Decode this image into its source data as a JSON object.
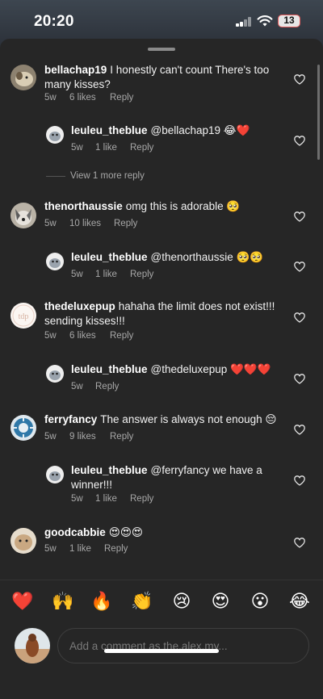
{
  "status": {
    "time": "20:20",
    "battery": "13"
  },
  "comments": [
    {
      "user": "bellachap19",
      "text": "I honestly can't count There's too many kisses?",
      "time": "5w",
      "likes": "6 likes",
      "reply": "Reply",
      "avatar": "avatar-dog"
    },
    {
      "user": "leuleu_theblue",
      "text": "@bellachap19 😂❤️",
      "time": "5w",
      "likes": "1 like",
      "reply": "Reply",
      "avatar": "avatar-leuleu"
    },
    {
      "user": "thenorthaussie",
      "text": "omg this is adorable 🥺",
      "time": "5w",
      "likes": "10 likes",
      "reply": "Reply",
      "avatar": "avatar-aussie"
    },
    {
      "user": "leuleu_theblue",
      "text": "@thenorthaussie 🥺🥺",
      "time": "5w",
      "likes": "1 like",
      "reply": "Reply",
      "avatar": "avatar-leuleu"
    },
    {
      "user": "thedeluxepup",
      "text": "hahaha the limit does not exist!!! sending kisses!!!",
      "time": "5w",
      "likes": "6 likes",
      "reply": "Reply",
      "avatar": "avatar-deluxepup"
    },
    {
      "user": "leuleu_theblue",
      "text": "@thedeluxepup ❤️❤️❤️",
      "time": "5w",
      "likes": "",
      "reply": "Reply",
      "avatar": "avatar-leuleu"
    },
    {
      "user": "ferryfancy",
      "text": "The answer is always not enough 😔",
      "time": "5w",
      "likes": "9 likes",
      "reply": "Reply",
      "avatar": "avatar-ferryfancy"
    },
    {
      "user": "leuleu_theblue",
      "text": "@ferryfancy we have a winner!!!",
      "time": "5w",
      "likes": "1 like",
      "reply": "Reply",
      "avatar": "avatar-leuleu"
    },
    {
      "user": "goodcabbie",
      "text": "😍😍😍",
      "time": "5w",
      "likes": "1 like",
      "reply": "Reply",
      "avatar": "avatar-goodcabbie"
    }
  ],
  "view_more": "View 1 more reply",
  "emoji_bar": [
    "❤️",
    "🙌",
    "🔥",
    "👏",
    "😢",
    "😍",
    "😮",
    "😂"
  ],
  "comment_input": {
    "placeholder": "Add a comment as the.alex.my..."
  },
  "icons": [
    "heart-icon",
    "signal-icon",
    "wifi-icon",
    "battery-icon"
  ]
}
